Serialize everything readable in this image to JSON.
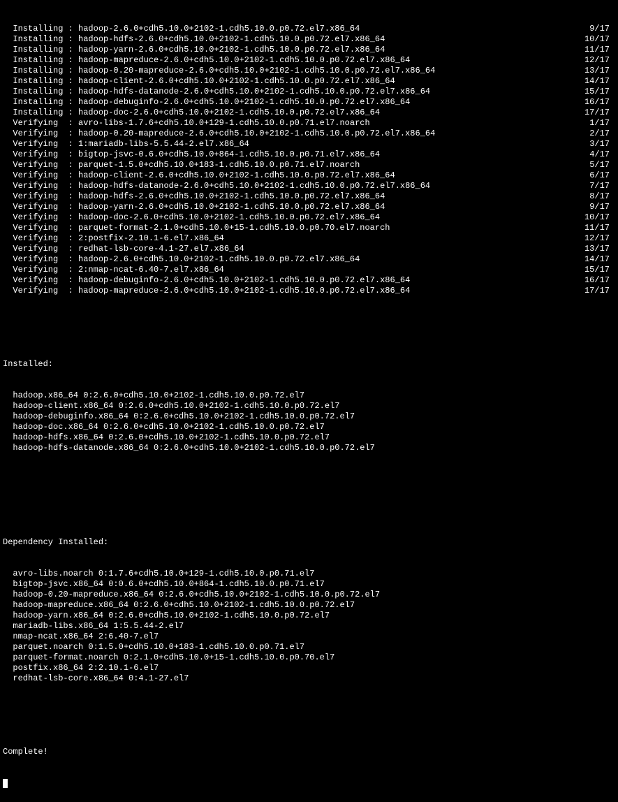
{
  "progress_lines": [
    {
      "action": "Installing",
      "pkg": "hadoop-2.6.0+cdh5.10.0+2102-1.cdh5.10.0.p0.72.el7.x86_64",
      "count": "9/17"
    },
    {
      "action": "Installing",
      "pkg": "hadoop-hdfs-2.6.0+cdh5.10.0+2102-1.cdh5.10.0.p0.72.el7.x86_64",
      "count": "10/17"
    },
    {
      "action": "Installing",
      "pkg": "hadoop-yarn-2.6.0+cdh5.10.0+2102-1.cdh5.10.0.p0.72.el7.x86_64",
      "count": "11/17"
    },
    {
      "action": "Installing",
      "pkg": "hadoop-mapreduce-2.6.0+cdh5.10.0+2102-1.cdh5.10.0.p0.72.el7.x86_64",
      "count": "12/17"
    },
    {
      "action": "Installing",
      "pkg": "hadoop-0.20-mapreduce-2.6.0+cdh5.10.0+2102-1.cdh5.10.0.p0.72.el7.x86_64",
      "count": "13/17"
    },
    {
      "action": "Installing",
      "pkg": "hadoop-client-2.6.0+cdh5.10.0+2102-1.cdh5.10.0.p0.72.el7.x86_64",
      "count": "14/17"
    },
    {
      "action": "Installing",
      "pkg": "hadoop-hdfs-datanode-2.6.0+cdh5.10.0+2102-1.cdh5.10.0.p0.72.el7.x86_64",
      "count": "15/17"
    },
    {
      "action": "Installing",
      "pkg": "hadoop-debuginfo-2.6.0+cdh5.10.0+2102-1.cdh5.10.0.p0.72.el7.x86_64",
      "count": "16/17"
    },
    {
      "action": "Installing",
      "pkg": "hadoop-doc-2.6.0+cdh5.10.0+2102-1.cdh5.10.0.p0.72.el7.x86_64",
      "count": "17/17"
    },
    {
      "action": "Verifying ",
      "pkg": "avro-libs-1.7.6+cdh5.10.0+129-1.cdh5.10.0.p0.71.el7.noarch",
      "count": "1/17"
    },
    {
      "action": "Verifying ",
      "pkg": "hadoop-0.20-mapreduce-2.6.0+cdh5.10.0+2102-1.cdh5.10.0.p0.72.el7.x86_64",
      "count": "2/17"
    },
    {
      "action": "Verifying ",
      "pkg": "1:mariadb-libs-5.5.44-2.el7.x86_64",
      "count": "3/17"
    },
    {
      "action": "Verifying ",
      "pkg": "bigtop-jsvc-0.6.0+cdh5.10.0+864-1.cdh5.10.0.p0.71.el7.x86_64",
      "count": "4/17"
    },
    {
      "action": "Verifying ",
      "pkg": "parquet-1.5.0+cdh5.10.0+183-1.cdh5.10.0.p0.71.el7.noarch",
      "count": "5/17"
    },
    {
      "action": "Verifying ",
      "pkg": "hadoop-client-2.6.0+cdh5.10.0+2102-1.cdh5.10.0.p0.72.el7.x86_64",
      "count": "6/17"
    },
    {
      "action": "Verifying ",
      "pkg": "hadoop-hdfs-datanode-2.6.0+cdh5.10.0+2102-1.cdh5.10.0.p0.72.el7.x86_64",
      "count": "7/17"
    },
    {
      "action": "Verifying ",
      "pkg": "hadoop-hdfs-2.6.0+cdh5.10.0+2102-1.cdh5.10.0.p0.72.el7.x86_64",
      "count": "8/17"
    },
    {
      "action": "Verifying ",
      "pkg": "hadoop-yarn-2.6.0+cdh5.10.0+2102-1.cdh5.10.0.p0.72.el7.x86_64",
      "count": "9/17"
    },
    {
      "action": "Verifying ",
      "pkg": "hadoop-doc-2.6.0+cdh5.10.0+2102-1.cdh5.10.0.p0.72.el7.x86_64",
      "count": "10/17"
    },
    {
      "action": "Verifying ",
      "pkg": "parquet-format-2.1.0+cdh5.10.0+15-1.cdh5.10.0.p0.70.el7.noarch",
      "count": "11/17"
    },
    {
      "action": "Verifying ",
      "pkg": "2:postfix-2.10.1-6.el7.x86_64",
      "count": "12/17"
    },
    {
      "action": "Verifying ",
      "pkg": "redhat-lsb-core-4.1-27.el7.x86_64",
      "count": "13/17"
    },
    {
      "action": "Verifying ",
      "pkg": "hadoop-2.6.0+cdh5.10.0+2102-1.cdh5.10.0.p0.72.el7.x86_64",
      "count": "14/17"
    },
    {
      "action": "Verifying ",
      "pkg": "2:nmap-ncat-6.40-7.el7.x86_64",
      "count": "15/17"
    },
    {
      "action": "Verifying ",
      "pkg": "hadoop-debuginfo-2.6.0+cdh5.10.0+2102-1.cdh5.10.0.p0.72.el7.x86_64",
      "count": "16/17"
    },
    {
      "action": "Verifying ",
      "pkg": "hadoop-mapreduce-2.6.0+cdh5.10.0+2102-1.cdh5.10.0.p0.72.el7.x86_64",
      "count": "17/17"
    }
  ],
  "installed_header": "Installed:",
  "installed": [
    "hadoop.x86_64 0:2.6.0+cdh5.10.0+2102-1.cdh5.10.0.p0.72.el7",
    "hadoop-client.x86_64 0:2.6.0+cdh5.10.0+2102-1.cdh5.10.0.p0.72.el7",
    "hadoop-debuginfo.x86_64 0:2.6.0+cdh5.10.0+2102-1.cdh5.10.0.p0.72.el7",
    "hadoop-doc.x86_64 0:2.6.0+cdh5.10.0+2102-1.cdh5.10.0.p0.72.el7",
    "hadoop-hdfs.x86_64 0:2.6.0+cdh5.10.0+2102-1.cdh5.10.0.p0.72.el7",
    "hadoop-hdfs-datanode.x86_64 0:2.6.0+cdh5.10.0+2102-1.cdh5.10.0.p0.72.el7"
  ],
  "dep_header": "Dependency Installed:",
  "dep_installed": [
    "avro-libs.noarch 0:1.7.6+cdh5.10.0+129-1.cdh5.10.0.p0.71.el7",
    "bigtop-jsvc.x86_64 0:0.6.0+cdh5.10.0+864-1.cdh5.10.0.p0.71.el7",
    "hadoop-0.20-mapreduce.x86_64 0:2.6.0+cdh5.10.0+2102-1.cdh5.10.0.p0.72.el7",
    "hadoop-mapreduce.x86_64 0:2.6.0+cdh5.10.0+2102-1.cdh5.10.0.p0.72.el7",
    "hadoop-yarn.x86_64 0:2.6.0+cdh5.10.0+2102-1.cdh5.10.0.p0.72.el7",
    "mariadb-libs.x86_64 1:5.5.44-2.el7",
    "nmap-ncat.x86_64 2:6.40-7.el7",
    "parquet.noarch 0:1.5.0+cdh5.10.0+183-1.cdh5.10.0.p0.71.el7",
    "parquet-format.noarch 0:2.1.0+cdh5.10.0+15-1.cdh5.10.0.p0.70.el7",
    "postfix.x86_64 2:2.10.1-6.el7",
    "redhat-lsb-core.x86_64 0:4.1-27.el7"
  ],
  "complete": "Complete!"
}
